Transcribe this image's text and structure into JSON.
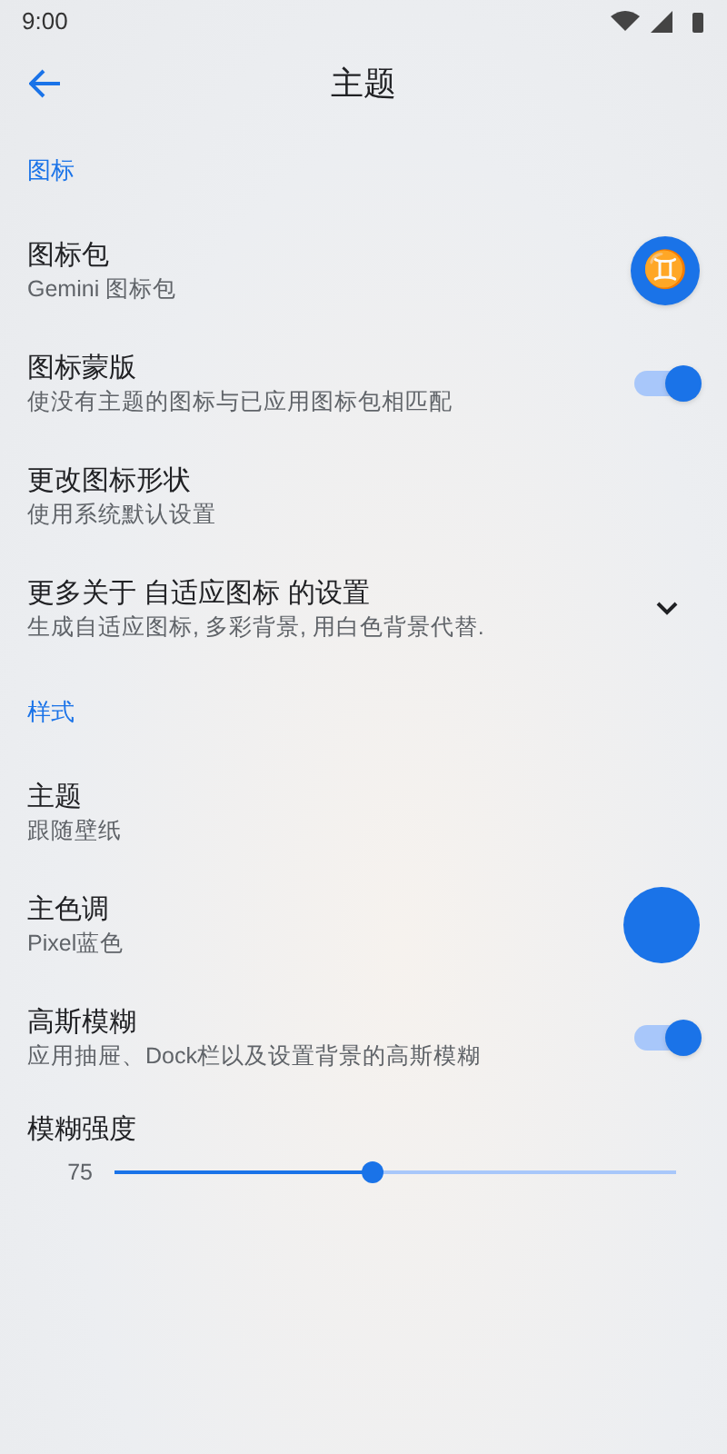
{
  "status_bar": {
    "time": "9:00"
  },
  "toolbar": {
    "title": "主题"
  },
  "sections": [
    {
      "header": "图标",
      "items": [
        {
          "kind": "icon",
          "title": "图标包",
          "subtitle": "Gemini 图标包",
          "glyph": "♊"
        },
        {
          "kind": "toggle",
          "title": "图标蒙版",
          "subtitle": "使没有主题的图标与已应用图标包相匹配",
          "on": true
        },
        {
          "kind": "plain",
          "title": "更改图标形状",
          "subtitle": "使用系统默认设置"
        },
        {
          "kind": "expand",
          "title": "更多关于 自适应图标 的设置",
          "subtitle": "生成自适应图标, 多彩背景, 用白色背景代替.",
          "expanded": false
        }
      ]
    },
    {
      "header": "样式",
      "items": [
        {
          "kind": "plain",
          "title": "主题",
          "subtitle": "跟随壁纸"
        },
        {
          "kind": "color",
          "title": "主色调",
          "subtitle": "Pixel蓝色",
          "color": "#1a73e8"
        },
        {
          "kind": "toggle",
          "title": "高斯模糊",
          "subtitle": "应用抽屉、Dock栏以及设置背景的高斯模糊",
          "on": true
        },
        {
          "kind": "slider",
          "title": "模糊强度",
          "reading": "75",
          "level": 0.46
        }
      ]
    }
  ]
}
